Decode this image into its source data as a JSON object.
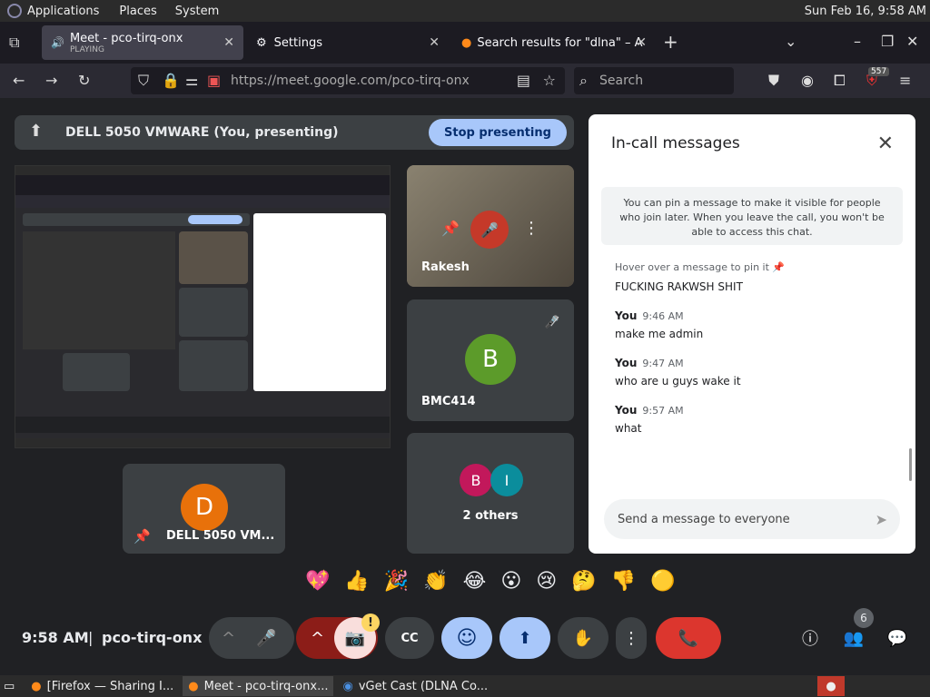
{
  "system_bar": {
    "menus": [
      "Applications",
      "Places",
      "System"
    ],
    "clock": "Sun Feb 16,  9:58 AM"
  },
  "tabs": [
    {
      "title": "Meet - pco-tirq-onx",
      "subtitle": "PLAYING",
      "close": "✕"
    },
    {
      "title": "Settings",
      "close": "✕"
    },
    {
      "title": "Search results for \"dlna\" – A",
      "close": "✕"
    }
  ],
  "new_tab": "+",
  "address_bar": {
    "url": "https://meet.google.com/pco-tirq-onx",
    "search_placeholder": "Search",
    "badge": "557"
  },
  "presenting_bar": {
    "label": "DELL 5050 VMWARE (You, presenting)",
    "stop_button": "Stop presenting"
  },
  "tiles": [
    {
      "name": "Rakesh"
    },
    {
      "name": "BMC414",
      "initial": "B",
      "color": "#5c9b2a"
    },
    {
      "name": "2 others",
      "initials": [
        "B",
        "I"
      ],
      "colors": [
        "#c2185b",
        "#0b8d9c"
      ]
    },
    {
      "name": "DELL 5050 VM...",
      "initial": "D",
      "color": "#e8710a"
    }
  ],
  "chat": {
    "title": "In-call messages",
    "notice": "You can pin a message to make it visible for people who join later. When you leave the call, you won't be able to access this chat.",
    "pin_hint": "Hover over a message to pin it",
    "first_message": "FUCKING RAKWSH SHIT",
    "messages": [
      {
        "sender": "You",
        "time": "9:46 AM",
        "text": "make me admin"
      },
      {
        "sender": "You",
        "time": "9:47 AM",
        "text": "who are u guys wake it"
      },
      {
        "sender": "You",
        "time": "9:57 AM",
        "text": "what"
      }
    ],
    "input_placeholder": "Send a message to everyone"
  },
  "reactions": [
    "💖",
    "👍",
    "🎉",
    "👏",
    "😂",
    "😮",
    "😢",
    "🤔",
    "👎",
    "🟡"
  ],
  "bottom_bar": {
    "time": "9:58 AM",
    "separator": "|",
    "meeting_code": "pco-tirq-onx",
    "people_count": "6",
    "alert": "!"
  },
  "taskbar": [
    {
      "label": "[Firefox — Sharing I..."
    },
    {
      "label": "Meet - pco-tirq-onx..."
    },
    {
      "label": "vGet Cast (DLNA Co..."
    }
  ],
  "icons": {
    "mic": "🎤",
    "camera_off": "📷",
    "captions": "CC",
    "emoji": "☺",
    "present": "⬆",
    "hand": "✋",
    "more": "⋮",
    "hangup": "📞",
    "info": "ⓘ",
    "people": "👥",
    "chat": "💬"
  },
  "colors": {
    "accent": "#a8c7fa",
    "hangup": "#dc362e",
    "camera_off": "#8c1d18",
    "active_ctrl": "#a8c7fa"
  }
}
